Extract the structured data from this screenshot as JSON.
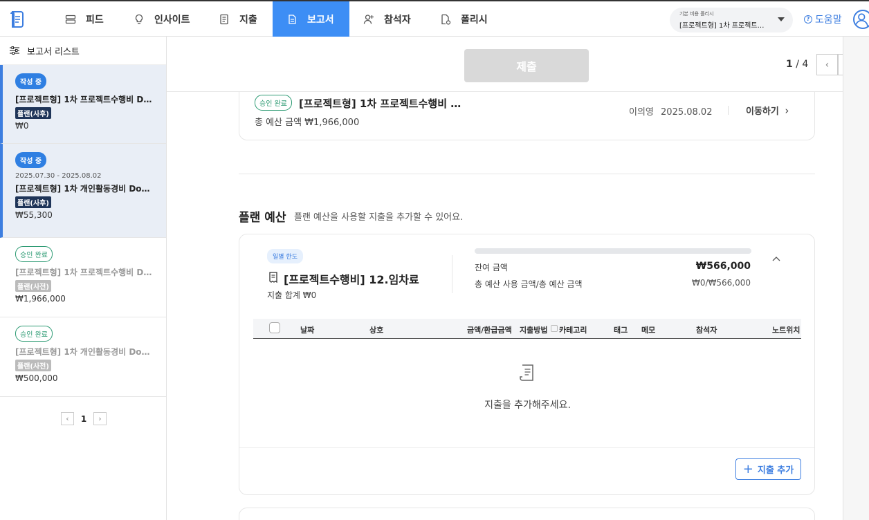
{
  "nav": {
    "items": [
      {
        "label": "피드",
        "icon": "feed-icon"
      },
      {
        "label": "인사이트",
        "icon": "lightbulb-icon"
      },
      {
        "label": "지출",
        "icon": "receipt-icon"
      },
      {
        "label": "보고서",
        "icon": "report-icon",
        "active": true
      },
      {
        "label": "참석자",
        "icon": "add-person-icon"
      },
      {
        "label": "폴리시",
        "icon": "policy-doc-icon"
      }
    ],
    "policy_label": "기본 비용 폴리시",
    "policy_value": "[프로젝트형] 1차 프로젝트수…",
    "help_label": "도움말"
  },
  "sidebar": {
    "title": "보고서 리스트",
    "reports": [
      {
        "status": "작성 중",
        "date": "",
        "title": "[프로젝트형] 1차 프로젝트수행비 Do…",
        "tag": "플랜(사후)",
        "amount": "₩0"
      },
      {
        "status": "작성 중",
        "date": "2025.07.30 - 2025.08.02",
        "title": "[프로젝트형] 1차 개인활동경비 Dou…",
        "tag": "플랜(사후)",
        "amount": "₩55,300"
      },
      {
        "status": "승인 완료",
        "date": "",
        "title": "[프로젝트형] 1차 프로젝트수행비 Do…",
        "tag": "플랜(사전)",
        "amount": "₩1,966,000"
      },
      {
        "status": "승인 완료",
        "date": "",
        "title": "[프로젝트형] 1차 개인활동경비 Dou…",
        "tag": "플랜(사전)",
        "amount": "₩500,000"
      }
    ],
    "page": "1"
  },
  "toolbar": {
    "submit_label": "제출",
    "page_current": "1",
    "page_total": "/ 4"
  },
  "top_card": {
    "status": "승인 완료",
    "title": "[프로젝트형] 1차 프로젝트수행비 …",
    "budget": "총 예산 금액 ₩1,966,000",
    "owner": "이의영",
    "date": "2025.08.02",
    "link": "이동하기"
  },
  "plan_section": {
    "title": "플랜 예산",
    "desc": "플랜 예산을 사용할 지출을 추가할 수 있어요."
  },
  "plan_card": {
    "badge": "일별 한도",
    "title": "[프로젝트수행비] 12.임차료",
    "expense_total": "지출 합계 ₩0",
    "remaining_label": "잔여 금액",
    "remaining_value": "₩566,000",
    "usage_label": "총 예산 사용 금액/총 예산 금액",
    "usage_value": "₩0/₩566,000",
    "usage_progress": 0,
    "columns": [
      "날짜",
      "상호",
      "금액/환급금액",
      "지출방법",
      "카테고리",
      "태그",
      "메모",
      "참석자",
      "노트위치"
    ],
    "empty_message": "지출을 추가해주세요.",
    "add_button": "지출 추가"
  },
  "colors": {
    "accent": "#3d8ef5",
    "approved": "#2b9a72",
    "tag_dark": "#1f3559"
  }
}
